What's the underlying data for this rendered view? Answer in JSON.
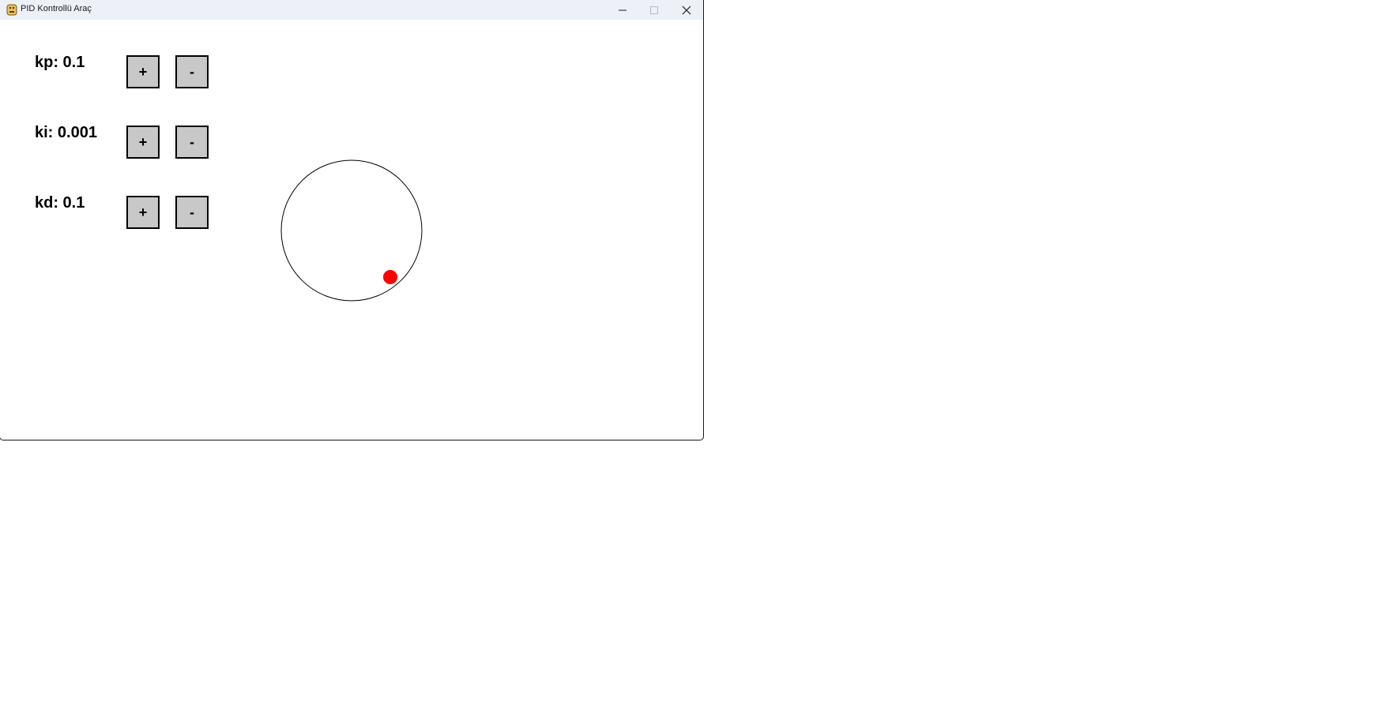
{
  "window": {
    "title": "PID Kontrollü Araç",
    "app_icon": "python-icon",
    "controls": {
      "minimize_icon": "minimize-icon",
      "maximize_icon": "maximize-icon",
      "close_icon": "close-icon"
    }
  },
  "params": {
    "kp": {
      "label": "kp: 0.1"
    },
    "ki": {
      "label": "ki: 0.001"
    },
    "kd": {
      "label": "kd: 0.1"
    }
  },
  "buttons": {
    "plus_label": "+",
    "minus_label": "-"
  },
  "colors": {
    "button_fill": "#c8c8c8",
    "ball": "#ff0000",
    "track": "#000000",
    "background": "#ffffff"
  }
}
